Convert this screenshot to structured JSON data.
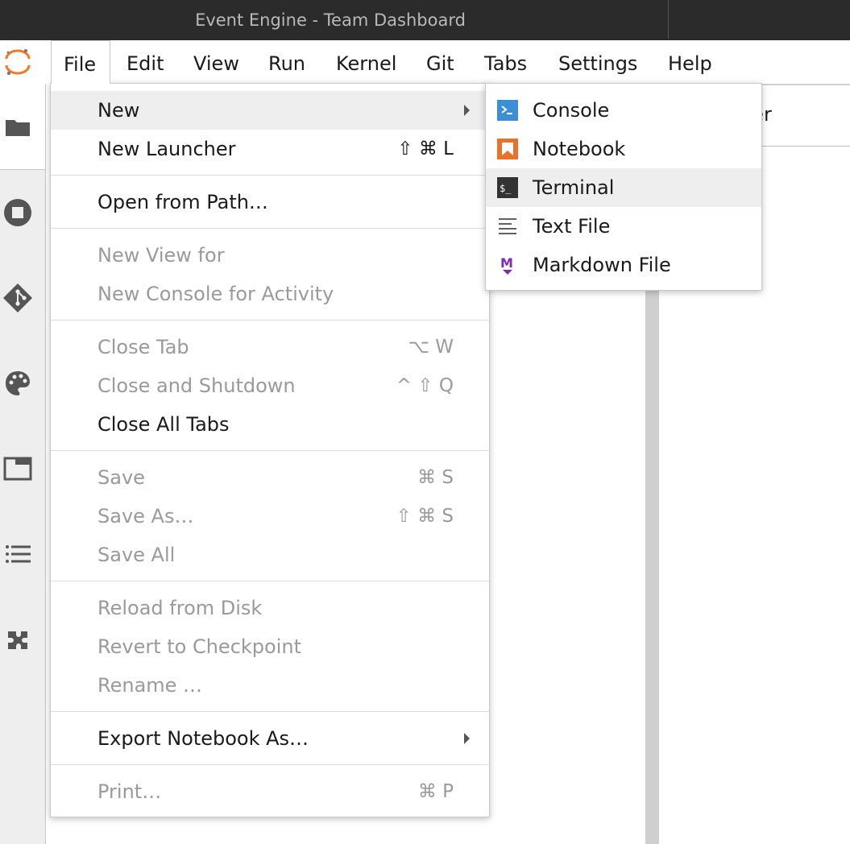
{
  "window": {
    "title": "Event Engine - Team Dashboard"
  },
  "menubar": {
    "items": [
      "File",
      "Edit",
      "View",
      "Run",
      "Kernel",
      "Git",
      "Tabs",
      "Settings",
      "Help"
    ],
    "active": "File"
  },
  "sidebar": {
    "icons": [
      "folder-icon",
      "running-icon",
      "git-icon",
      "palette-icon",
      "tabs-icon",
      "toc-icon",
      "extension-icon"
    ]
  },
  "tab": {
    "partial_label": "ner"
  },
  "file_menu": {
    "new": {
      "label": "New"
    },
    "new_launcher": {
      "label": "New Launcher",
      "shortcut": "⇧ ⌘ L"
    },
    "open_from_path": {
      "label": "Open from Path…"
    },
    "new_view_for": {
      "label": "New View for"
    },
    "new_console_for_activity": {
      "label": "New Console for Activity"
    },
    "close_tab": {
      "label": "Close Tab",
      "shortcut": "⌥ W"
    },
    "close_and_shutdown": {
      "label": "Close and Shutdown",
      "shortcut": "^ ⇧ Q"
    },
    "close_all_tabs": {
      "label": "Close All Tabs"
    },
    "save": {
      "label": "Save",
      "shortcut": "⌘ S"
    },
    "save_as": {
      "label": "Save As…",
      "shortcut": "⇧ ⌘ S"
    },
    "save_all": {
      "label": "Save All"
    },
    "reload_from_disk": {
      "label": "Reload from Disk"
    },
    "revert_to_checkpoint": {
      "label": "Revert to Checkpoint"
    },
    "rename": {
      "label": "Rename …"
    },
    "export_notebook_as": {
      "label": "Export Notebook As…"
    },
    "print": {
      "label": "Print…",
      "shortcut": "⌘ P"
    }
  },
  "new_submenu": {
    "console": {
      "label": "Console",
      "icon": "console-icon",
      "color": "#3c8fd6"
    },
    "notebook": {
      "label": "Notebook",
      "icon": "notebook-icon",
      "color": "#e7722c"
    },
    "terminal": {
      "label": "Terminal",
      "icon": "terminal-icon",
      "color": "#333333"
    },
    "text_file": {
      "label": "Text File",
      "icon": "text-file-icon",
      "color": "#616161"
    },
    "markdown_file": {
      "label": "Markdown File",
      "icon": "markdown-icon",
      "color": "#7b2cb5"
    }
  },
  "colors": {
    "titlebar": "#2b2b2b",
    "hover": "#eeeeee",
    "disabled_text": "#9a9a9a",
    "brand_orange": "#f37726"
  }
}
